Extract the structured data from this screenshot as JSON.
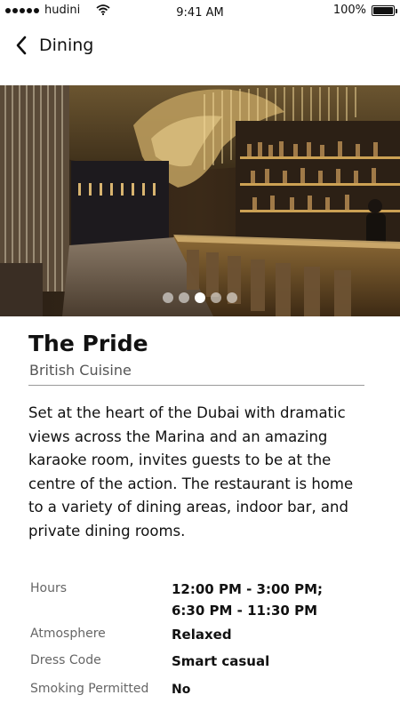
{
  "status_bar": {
    "carrier": "hudini",
    "time": "9:41 AM",
    "battery": "100%",
    "battery_level": 1.0,
    "signal_bars": 5
  },
  "nav": {
    "back_icon": "chevron-left-icon",
    "title": "Dining"
  },
  "hero": {
    "pages": 5,
    "active_page": 3
  },
  "restaurant": {
    "name": "The Pride",
    "cuisine": "British Cuisine",
    "description": "Set at the heart of the Dubai with dramatic views across the Marina and an amazing karaoke room, invites guests to be at the centre of the action. The restaurant is home to a variety of dining areas, indoor bar, and private dining rooms."
  },
  "info": {
    "hours_label": "Hours",
    "hours_line1": "12:00 PM - 3:00 PM;",
    "hours_line2": "6:30 PM - 11:30 PM",
    "atmosphere_label": "Atmosphere",
    "atmosphere_value": "Relaxed",
    "dress_code_label": "Dress Code",
    "dress_code_value": "Smart casual",
    "smoking_label": "Smoking Permitted",
    "smoking_value": "No"
  }
}
